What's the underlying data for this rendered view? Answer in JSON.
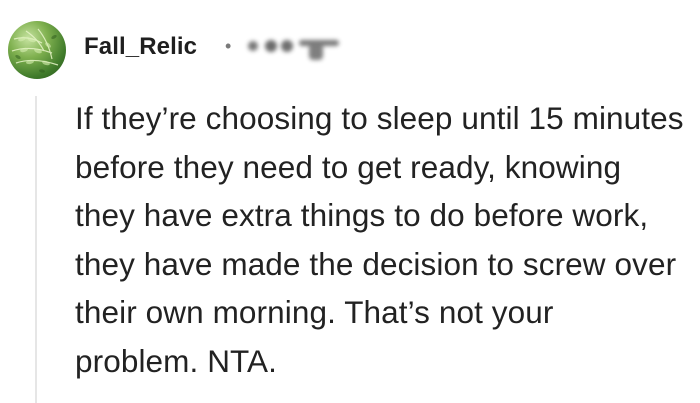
{
  "comment": {
    "author": "Fall_Relic",
    "meta_separator": "•",
    "body": "If they’re choosing to sleep until 15 minutes before they need to get ready, knowing they have extra things to do before work, they have made the decision to screw over their own morning. That’s not your problem. NTA."
  },
  "icons": {
    "avatar": "fern-leaves-avatar",
    "meta": "blurred-redacted-metadata"
  },
  "colors": {
    "background": "#ffffff",
    "text": "#222222",
    "thread_line": "#e6e6e6",
    "meta": "#7a7a7a"
  }
}
